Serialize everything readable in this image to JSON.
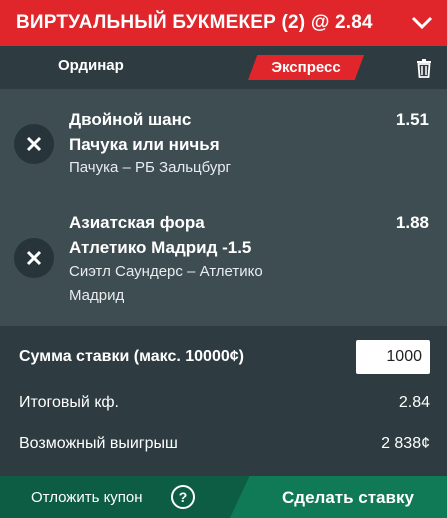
{
  "header": {
    "title": "ВИРТУАЛЬНЫЙ БУКМЕКЕР (2) @ 2.84",
    "chevron_icon": "chevron-down-icon"
  },
  "tabs": {
    "single_label": "Ординар",
    "express_label": "Экспресс",
    "active": "express",
    "trash_icon": "trash-icon"
  },
  "bets": [
    {
      "market": "Двойной шанс",
      "selection": "Пачука или ничья",
      "event": "Пачука – РБ Зальцбург",
      "odds": "1.51"
    },
    {
      "market": "Азиатская фора",
      "selection": "Атлетико Мадрид -1.5",
      "event": "Сиэтл Саундерс – Атлетико Мадрид",
      "odds": "1.88"
    }
  ],
  "summary": {
    "stake_label": "Сумма ставки (макс. 10000¢)",
    "stake_value": "1000",
    "total_odds_label": "Итоговый кф.",
    "total_odds_value": "2.84",
    "possible_win_label": "Возможный выигрыш",
    "possible_win_value": "2 838¢"
  },
  "footer": {
    "save_label": "Отложить купон",
    "help_symbol": "?",
    "place_label": "Сделать ставку"
  },
  "colors": {
    "brand_red": "#e0262b",
    "panel_dark": "#2e3b40",
    "panel_mid": "#3e4d52",
    "green_dark": "#0d5d45",
    "green": "#0f7a55"
  }
}
